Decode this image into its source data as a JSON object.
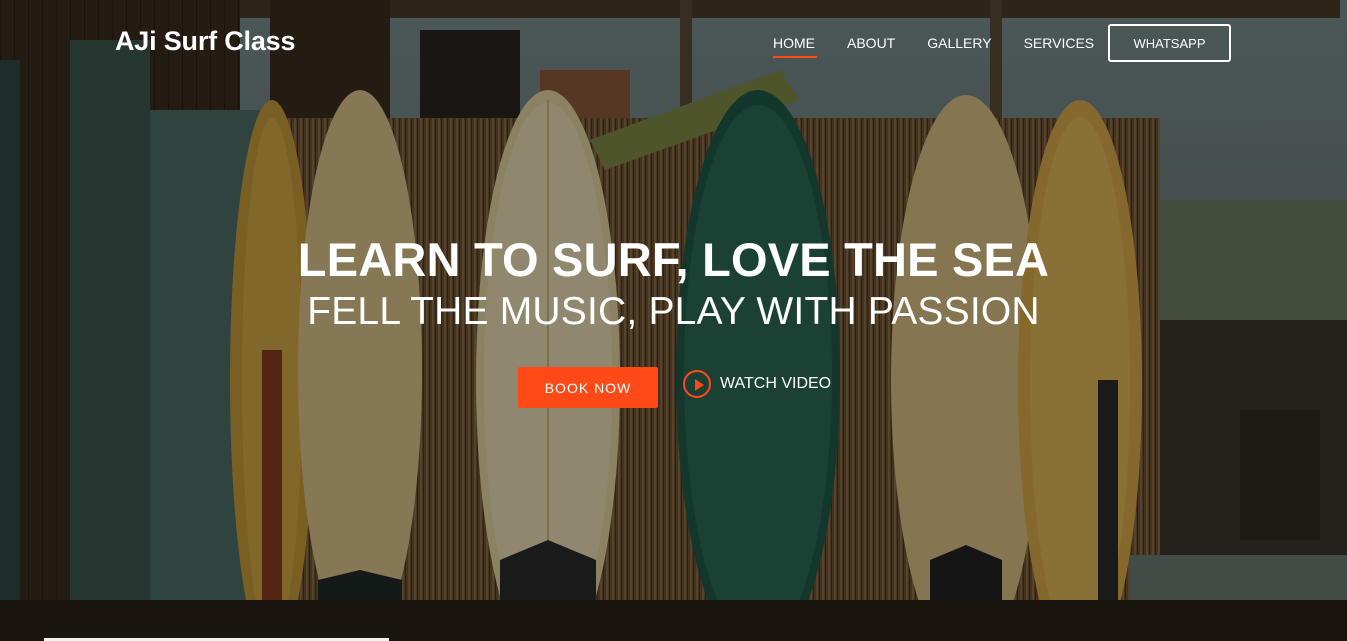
{
  "brand": {
    "name": "AJi Surf Class"
  },
  "nav": {
    "items": [
      {
        "label": "HOME",
        "active": true
      },
      {
        "label": "ABOUT",
        "active": false
      },
      {
        "label": "GALLERY",
        "active": false
      },
      {
        "label": "SERVICES",
        "active": false
      }
    ],
    "whatsapp_label": "WHATSAPP"
  },
  "hero": {
    "headline": "LEARN TO SURF, LOVE THE SEA",
    "subheadline": "FELL THE MUSIC, PLAY WITH PASSION",
    "book_label": "BOOK NOW",
    "watch_label": "WATCH VIDEO",
    "background_image": "surfboards-leaning-on-reed-fence-photo"
  },
  "colors": {
    "accent": "#ff4a17",
    "text": "#ffffff",
    "overlay": "rgba(0,0,0,0.38)"
  },
  "icons": {
    "watch": "play-circle-icon"
  }
}
